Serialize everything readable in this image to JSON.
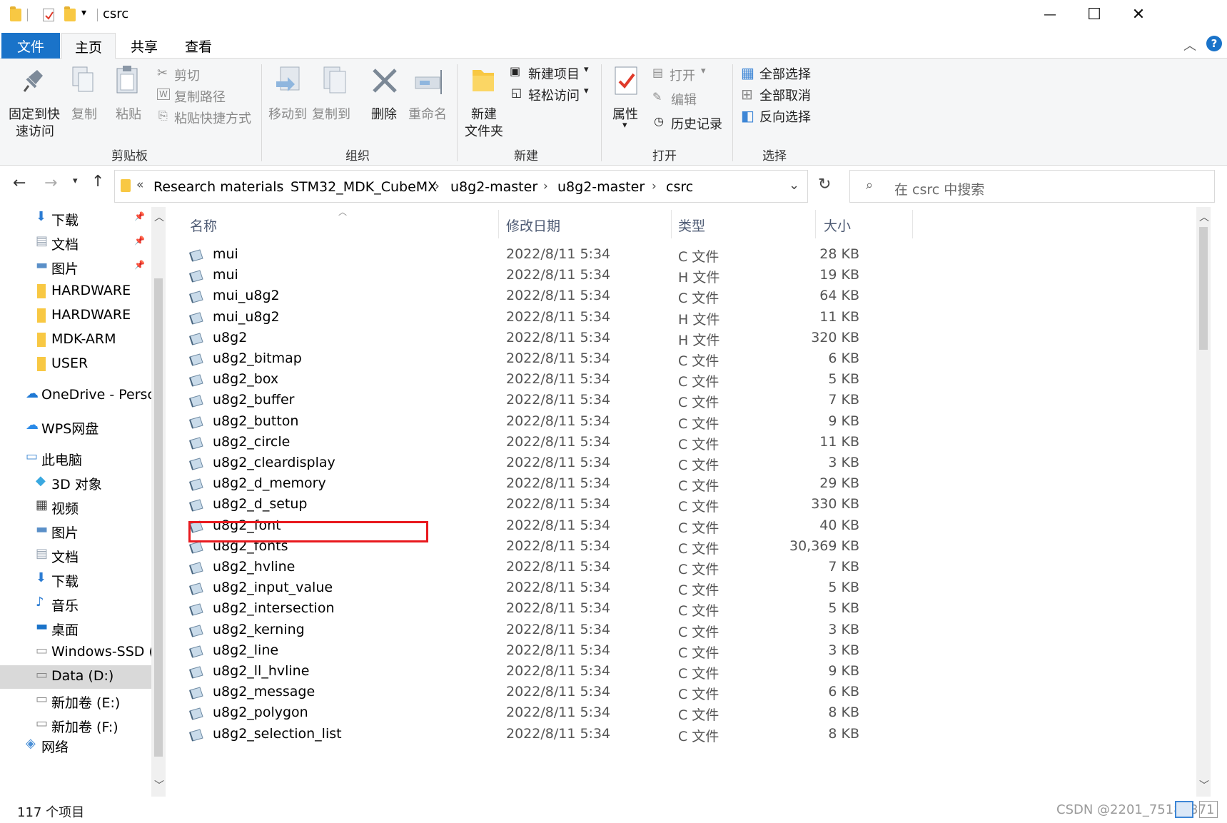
{
  "window": {
    "title": "csrc",
    "minimize": "—",
    "maximize": "☐",
    "close": "✕"
  },
  "tabs": {
    "file": "文件",
    "home": "主页",
    "share": "共享",
    "view": "查看"
  },
  "ribbon": {
    "pin_quick_line1": "固定到快",
    "pin_quick_line2": "速访问",
    "copy": "复制",
    "paste": "粘贴",
    "cut": "剪切",
    "copy_path": "复制路径",
    "paste_shortcut": "粘贴快捷方式",
    "clipboard_group": "剪贴板",
    "move_to": "移动到",
    "copy_to": "复制到",
    "delete": "删除",
    "rename": "重命名",
    "organize_group": "组织",
    "new_folder_line1": "新建",
    "new_folder_line2": "文件夹",
    "new_item": "新建项目",
    "easy_access": "轻松访问",
    "new_group": "新建",
    "properties": "属性",
    "open": "打开",
    "edit": "编辑",
    "history": "历史记录",
    "open_group": "打开",
    "select_all": "全部选择",
    "select_none": "全部取消",
    "invert_selection": "反向选择",
    "select_group": "选择"
  },
  "address": {
    "overflow": "«",
    "crumbs": [
      "Research materials",
      "STM32_MDK_CubeMX",
      "u8g2-master",
      "u8g2-master",
      "csrc"
    ],
    "search_placeholder": "在 csrc 中搜索"
  },
  "nav": [
    {
      "label": "下载",
      "icon": "download-icon",
      "pinned": true
    },
    {
      "label": "文档",
      "icon": "document-icon",
      "pinned": true
    },
    {
      "label": "图片",
      "icon": "picture-icon",
      "pinned": true
    },
    {
      "label": "HARDWARE",
      "icon": "folder-icon",
      "pinned": false
    },
    {
      "label": "HARDWARE",
      "icon": "folder-icon",
      "pinned": false
    },
    {
      "label": "MDK-ARM",
      "icon": "folder-icon",
      "pinned": false
    },
    {
      "label": "USER",
      "icon": "folder-icon",
      "pinned": false
    },
    {
      "label": "OneDrive - Persc",
      "icon": "onedrive-icon",
      "pinned": false
    },
    {
      "label": "WPS网盘",
      "icon": "cloud-icon",
      "pinned": false
    },
    {
      "label": "此电脑",
      "icon": "computer-icon",
      "pinned": false
    },
    {
      "label": "3D 对象",
      "icon": "3d-objects-icon",
      "pinned": false
    },
    {
      "label": "视频",
      "icon": "video-icon",
      "pinned": false
    },
    {
      "label": "图片",
      "icon": "picture-icon",
      "pinned": false
    },
    {
      "label": "文档",
      "icon": "document-icon",
      "pinned": false
    },
    {
      "label": "下载",
      "icon": "download-icon",
      "pinned": false
    },
    {
      "label": "音乐",
      "icon": "music-icon",
      "pinned": false
    },
    {
      "label": "桌面",
      "icon": "desktop-icon",
      "pinned": false
    },
    {
      "label": "Windows-SSD (",
      "icon": "drive-c-icon",
      "pinned": false
    },
    {
      "label": "Data (D:)",
      "icon": "drive-icon",
      "pinned": false,
      "selected": true
    },
    {
      "label": "新加卷 (E:)",
      "icon": "drive-icon",
      "pinned": false
    },
    {
      "label": "新加卷 (F:)",
      "icon": "drive-icon",
      "pinned": false
    },
    {
      "label": "网络",
      "icon": "network-icon",
      "pinned": false
    }
  ],
  "columns": {
    "name": "名称",
    "date": "修改日期",
    "type": "类型",
    "size": "大小"
  },
  "files": [
    {
      "name": "mui",
      "date": "2022/8/11 5:34",
      "type": "C 文件",
      "size": "28 KB"
    },
    {
      "name": "mui",
      "date": "2022/8/11 5:34",
      "type": "H 文件",
      "size": "19 KB"
    },
    {
      "name": "mui_u8g2",
      "date": "2022/8/11 5:34",
      "type": "C 文件",
      "size": "64 KB"
    },
    {
      "name": "mui_u8g2",
      "date": "2022/8/11 5:34",
      "type": "H 文件",
      "size": "11 KB"
    },
    {
      "name": "u8g2",
      "date": "2022/8/11 5:34",
      "type": "H 文件",
      "size": "320 KB"
    },
    {
      "name": "u8g2_bitmap",
      "date": "2022/8/11 5:34",
      "type": "C 文件",
      "size": "6 KB"
    },
    {
      "name": "u8g2_box",
      "date": "2022/8/11 5:34",
      "type": "C 文件",
      "size": "5 KB"
    },
    {
      "name": "u8g2_buffer",
      "date": "2022/8/11 5:34",
      "type": "C 文件",
      "size": "7 KB"
    },
    {
      "name": "u8g2_button",
      "date": "2022/8/11 5:34",
      "type": "C 文件",
      "size": "9 KB"
    },
    {
      "name": "u8g2_circle",
      "date": "2022/8/11 5:34",
      "type": "C 文件",
      "size": "11 KB"
    },
    {
      "name": "u8g2_cleardisplay",
      "date": "2022/8/11 5:34",
      "type": "C 文件",
      "size": "3 KB"
    },
    {
      "name": "u8g2_d_memory",
      "date": "2022/8/11 5:34",
      "type": "C 文件",
      "size": "29 KB"
    },
    {
      "name": "u8g2_d_setup",
      "date": "2022/8/11 5:34",
      "type": "C 文件",
      "size": "330 KB"
    },
    {
      "name": "u8g2_font",
      "date": "2022/8/11 5:34",
      "type": "C 文件",
      "size": "40 KB"
    },
    {
      "name": "u8g2_fonts",
      "date": "2022/8/11 5:34",
      "type": "C 文件",
      "size": "30,369 KB"
    },
    {
      "name": "u8g2_hvline",
      "date": "2022/8/11 5:34",
      "type": "C 文件",
      "size": "7 KB"
    },
    {
      "name": "u8g2_input_value",
      "date": "2022/8/11 5:34",
      "type": "C 文件",
      "size": "5 KB"
    },
    {
      "name": "u8g2_intersection",
      "date": "2022/8/11 5:34",
      "type": "C 文件",
      "size": "5 KB"
    },
    {
      "name": "u8g2_kerning",
      "date": "2022/8/11 5:34",
      "type": "C 文件",
      "size": "3 KB"
    },
    {
      "name": "u8g2_line",
      "date": "2022/8/11 5:34",
      "type": "C 文件",
      "size": "3 KB"
    },
    {
      "name": "u8g2_ll_hvline",
      "date": "2022/8/11 5:34",
      "type": "C 文件",
      "size": "9 KB"
    },
    {
      "name": "u8g2_message",
      "date": "2022/8/11 5:34",
      "type": "C 文件",
      "size": "6 KB"
    },
    {
      "name": "u8g2_polygon",
      "date": "2022/8/11 5:34",
      "type": "C 文件",
      "size": "8 KB"
    },
    {
      "name": "u8g2_selection_list",
      "date": "2022/8/11 5:34",
      "type": "C 文件",
      "size": "8 KB"
    }
  ],
  "status": {
    "count": "117 个项目",
    "watermark": "CSDN @2201_75183371"
  },
  "colors": {
    "accent": "#1a73c9",
    "highlight_box": "#e8191e",
    "folder": "#f8c843"
  }
}
